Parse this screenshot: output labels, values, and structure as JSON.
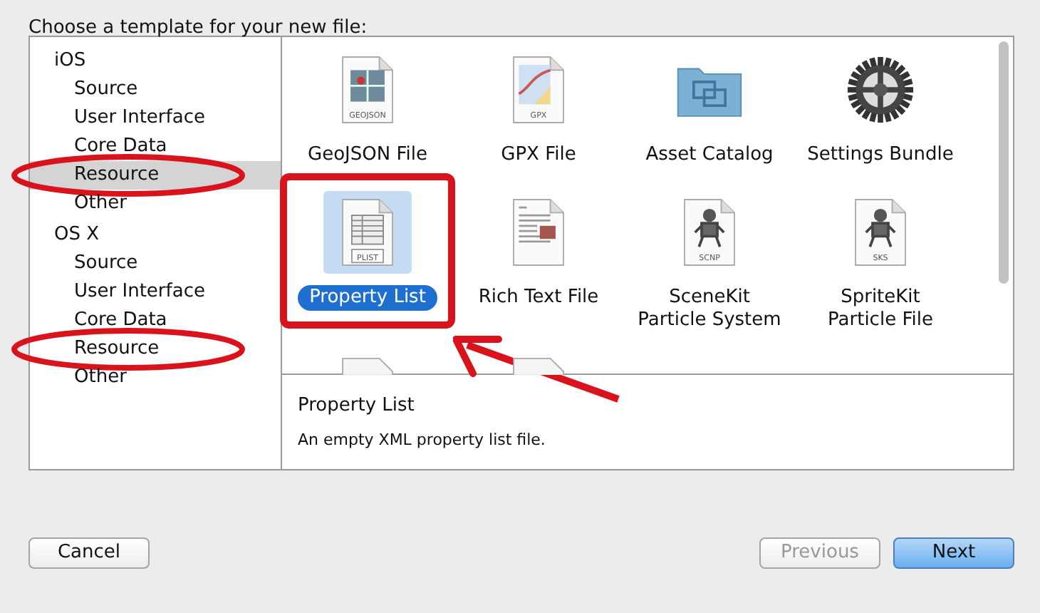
{
  "prompt": "Choose a template for your new file:",
  "sidebar": {
    "groups": [
      {
        "label": "iOS",
        "children": [
          {
            "label": "Source",
            "selected": false,
            "circled": false
          },
          {
            "label": "User Interface",
            "selected": false,
            "circled": false
          },
          {
            "label": "Core Data",
            "selected": false,
            "circled": false
          },
          {
            "label": "Resource",
            "selected": true,
            "circled": true
          },
          {
            "label": "Other",
            "selected": false,
            "circled": false
          }
        ]
      },
      {
        "label": "OS X",
        "children": [
          {
            "label": "Source",
            "selected": false,
            "circled": false
          },
          {
            "label": "User Interface",
            "selected": false,
            "circled": false
          },
          {
            "label": "Core Data",
            "selected": false,
            "circled": false
          },
          {
            "label": "Resource",
            "selected": false,
            "circled": true
          },
          {
            "label": "Other",
            "selected": false,
            "circled": false
          }
        ]
      }
    ]
  },
  "templates": [
    {
      "kind": "geojson",
      "badge": "GEOJSON",
      "label_lines": [
        "GeoJSON File"
      ],
      "selected": false,
      "boxed": false
    },
    {
      "kind": "gpx",
      "badge": "GPX",
      "label_lines": [
        "GPX File"
      ],
      "selected": false,
      "boxed": false
    },
    {
      "kind": "folder",
      "label_lines": [
        "Asset Catalog"
      ],
      "selected": false,
      "boxed": false
    },
    {
      "kind": "gear",
      "label_lines": [
        "Settings Bundle"
      ],
      "selected": false,
      "boxed": false
    },
    {
      "kind": "plist",
      "badge": "PLIST",
      "label_lines": [
        "Property List"
      ],
      "selected": true,
      "boxed": true
    },
    {
      "kind": "rtf",
      "label_lines": [
        "Rich Text File"
      ],
      "selected": false,
      "boxed": false
    },
    {
      "kind": "particle",
      "badge": "SCNP",
      "label_lines": [
        "SceneKit",
        "Particle System"
      ],
      "selected": false,
      "boxed": false
    },
    {
      "kind": "particle",
      "badge": "SKS",
      "label_lines": [
        "SpriteKit",
        "Particle File"
      ],
      "selected": false,
      "boxed": false
    },
    {
      "kind": "clipped"
    },
    {
      "kind": "clipped"
    }
  ],
  "detail": {
    "title": "Property List",
    "description": "An empty XML property list file."
  },
  "buttons": [
    {
      "label": "Cancel",
      "kind": "cancel",
      "disabled": false,
      "default": false
    },
    {
      "label": "Previous",
      "kind": "previous",
      "disabled": true,
      "default": false
    },
    {
      "label": "Next",
      "kind": "next",
      "disabled": false,
      "default": true
    }
  ]
}
